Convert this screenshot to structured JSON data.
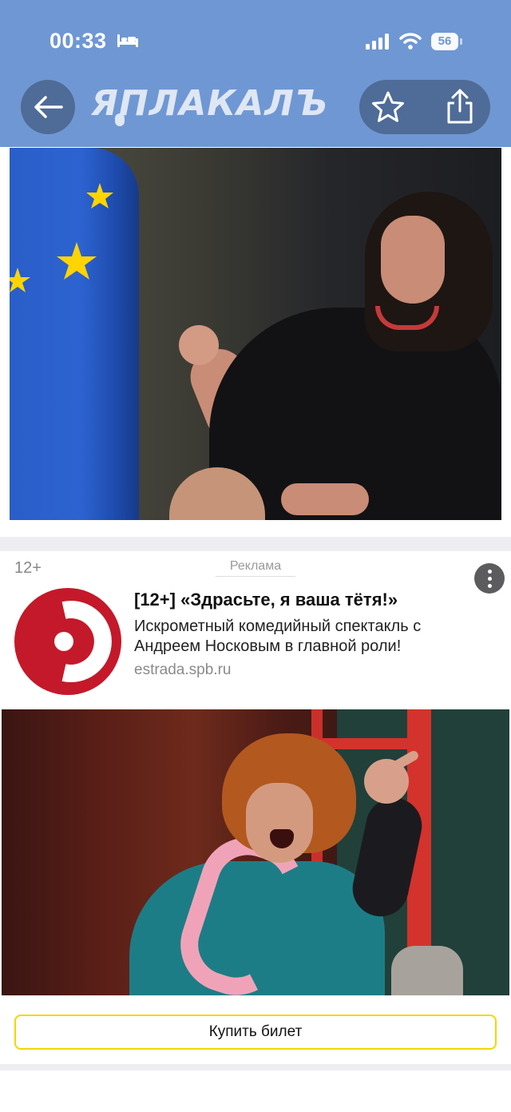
{
  "status_bar": {
    "time": "00:33",
    "battery": "56"
  },
  "header": {
    "logo_text": "ЯПЛАКАЛЪ",
    "background_color": "#6f97d3",
    "button_color": "#4f6b97"
  },
  "icons": {
    "back": "arrow-left-icon",
    "favorite": "star-icon",
    "share": "share-icon",
    "sleep": "bed-icon",
    "signal": "cellular-signal-icon",
    "wifi": "wifi-icon",
    "menu": "more-vertical-icon"
  },
  "ad": {
    "age_rating": "12+",
    "label": "Реклама",
    "title": "[12+] «Здрасьте, я ваша тётя!»",
    "description": "Искрометный комедийный спектакль с Андреем Носковым в главной роли!",
    "domain": "estrada.spb.ru",
    "cta_label": "Купить билет",
    "logo_color": "#c4192a",
    "cta_border_color": "#f5d600"
  }
}
